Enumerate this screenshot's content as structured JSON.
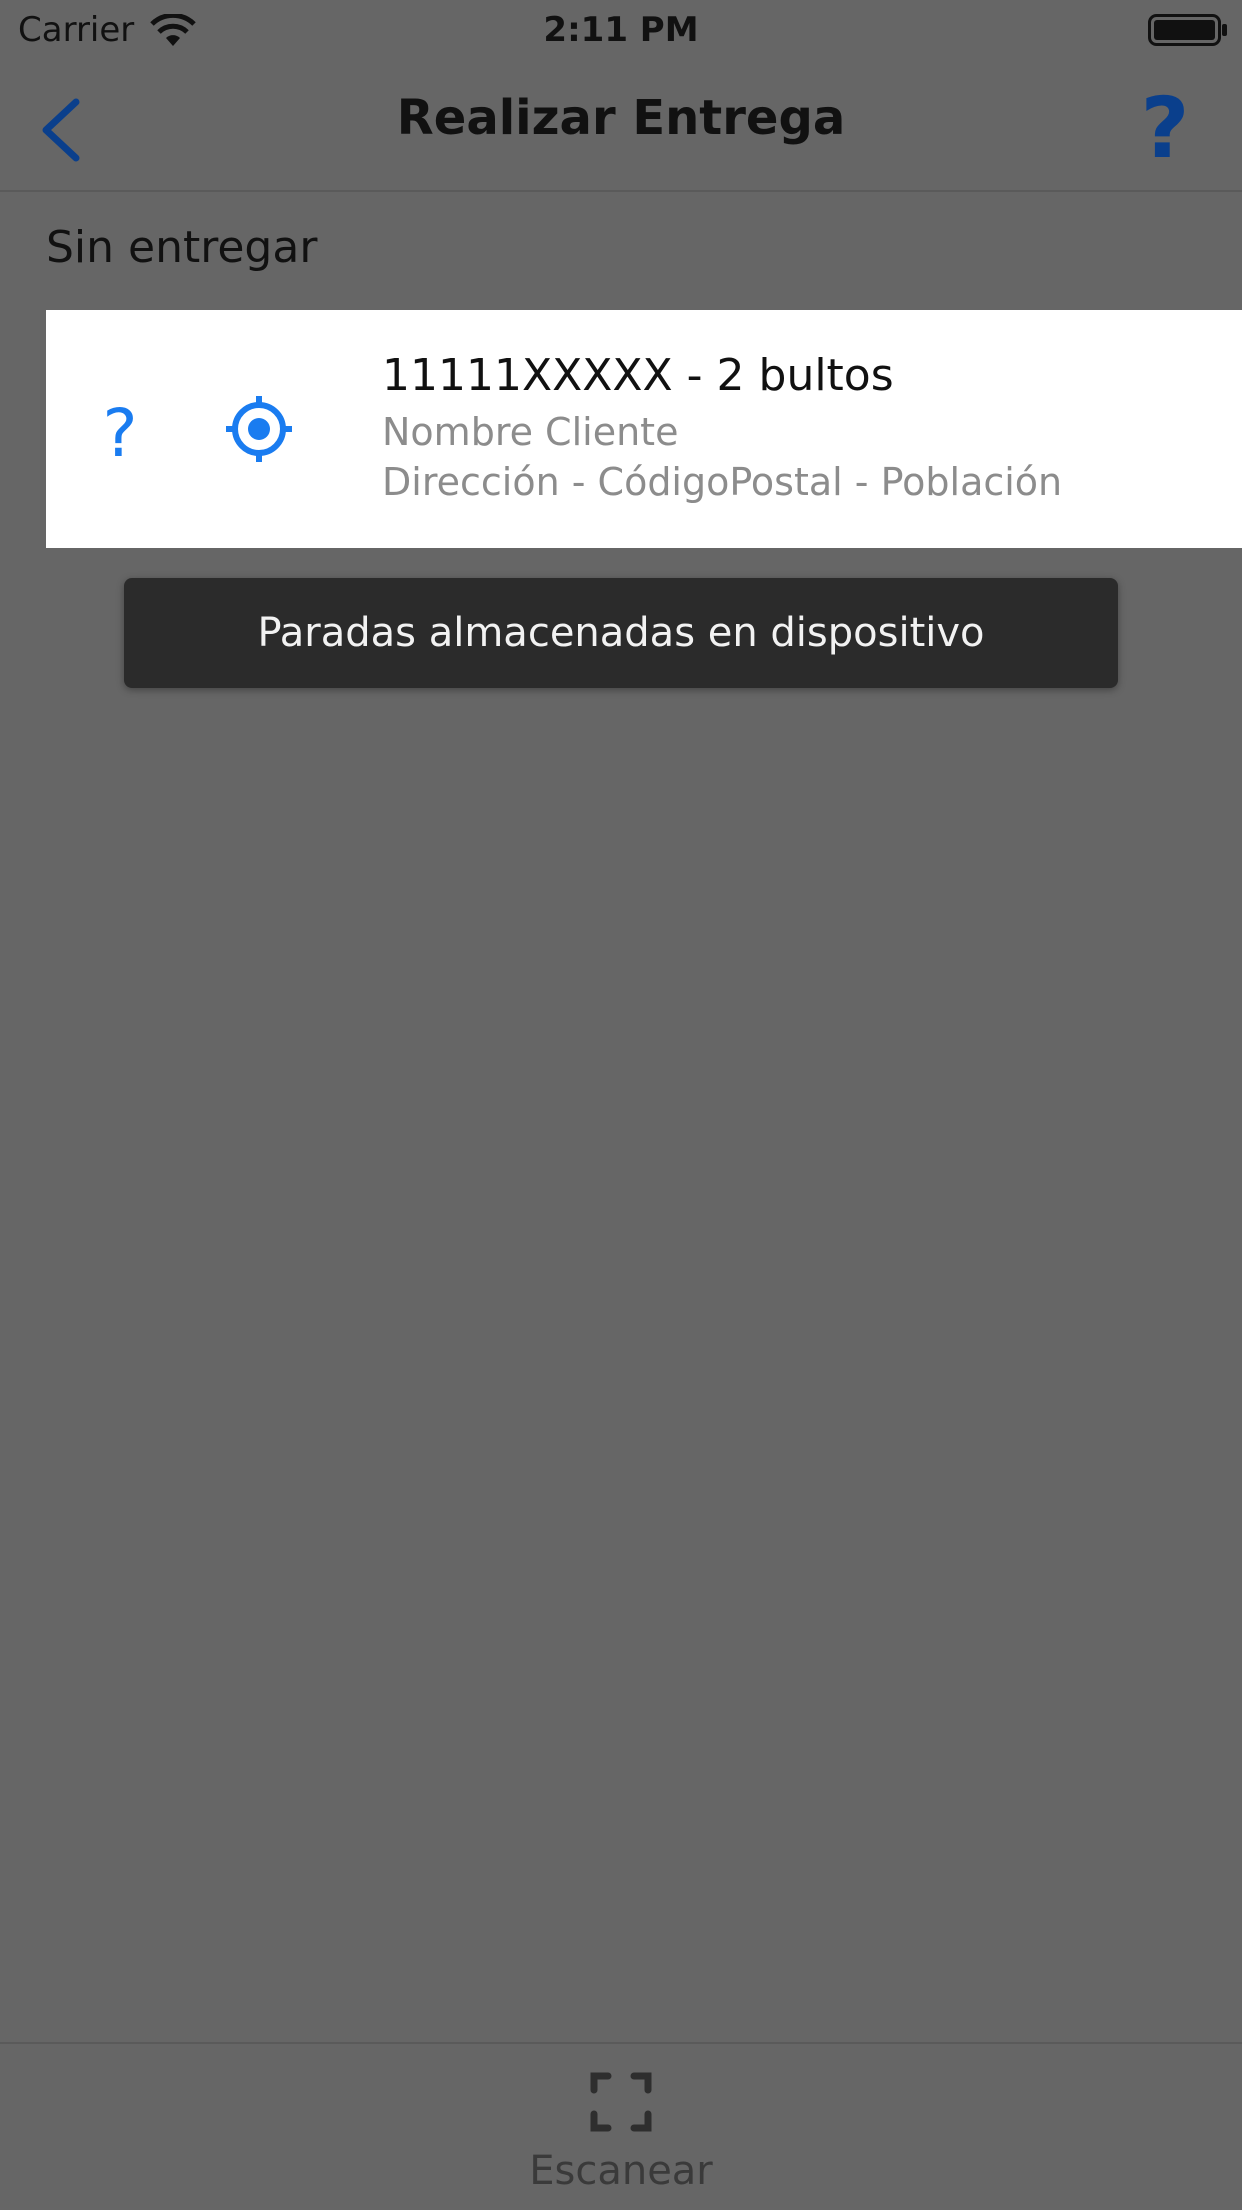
{
  "status_bar": {
    "carrier": "Carrier",
    "time": "2:11 PM"
  },
  "nav": {
    "title": "Realizar Entrega",
    "back_icon": "chevron-left-icon",
    "help_label": "?"
  },
  "section": {
    "header": "Sin entregar"
  },
  "row": {
    "status_glyph": "?",
    "title": "11111XXXXX - 2 bultos",
    "client": "Nombre Cliente",
    "address": "Dirección - CódigoPostal - Población",
    "locate_icon": "target-icon"
  },
  "toast": {
    "message": "Paradas almacenadas en dispositivo"
  },
  "bottom_bar": {
    "scan_label": "Escanear",
    "scan_icon": "scan-frame-icon"
  },
  "colors": {
    "background": "#666666",
    "accent_blue": "#1a7cf0",
    "nav_blue": "#0a3f8c",
    "row_bg": "#ffffff",
    "toast_bg": "#2b2b2b"
  }
}
